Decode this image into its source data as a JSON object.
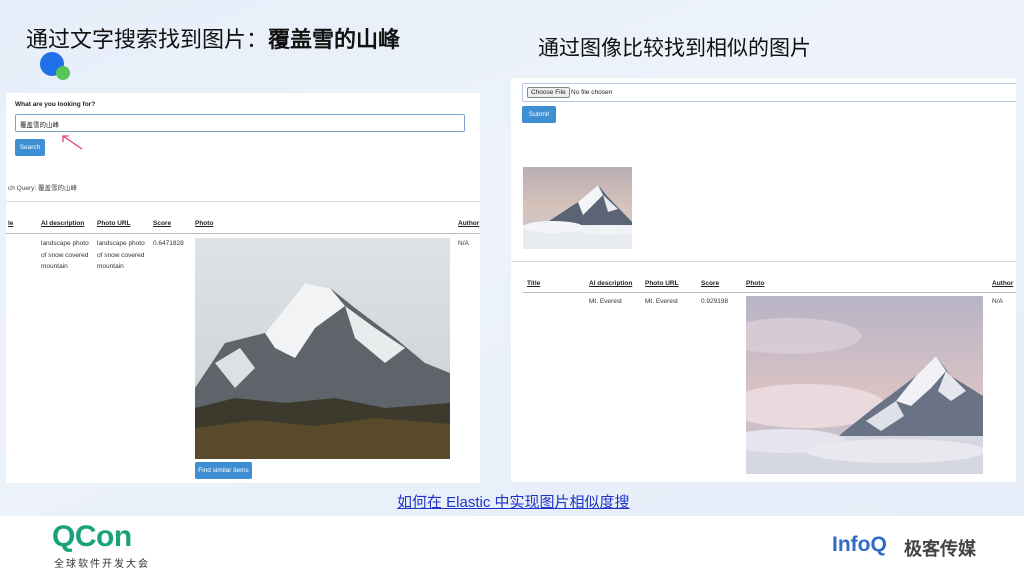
{
  "slide": {
    "title_left_prefix": "通过文字搜索找到图片：",
    "title_left_bold": "覆盖雪的山峰",
    "title_right": "通过图像比较找到相似的图片",
    "bottom_link": "如何在 Elastic 中实现图片相似度搜"
  },
  "left_app": {
    "prompt_label": "What are you looking for?",
    "search_value": "覆盖雪的山峰",
    "search_button": "Search",
    "query_text": "ch Query: 覆盖雪的山峰",
    "columns": [
      "le",
      "AI description",
      "Photo URL",
      "Score",
      "Photo",
      "Author"
    ],
    "row": {
      "ai_description": [
        "landscape photo",
        "of snow covered",
        "mountain"
      ],
      "photo_url": [
        "landscape photo",
        "of snow covered",
        "mountain"
      ],
      "score": "0.6471828",
      "author": "N/A"
    },
    "find_similar_button": "Find similar items"
  },
  "right_app": {
    "choose_file_button": "Choose File",
    "file_status": "No file chosen",
    "submit_button": "Submit",
    "columns": [
      "Title",
      "AI description",
      "Photo URL",
      "Score",
      "Photo",
      "Author"
    ],
    "row": {
      "ai_description": "Mt. Everest",
      "photo_url": "Mt. Everest",
      "score": "0.929198",
      "author": "N/A"
    }
  },
  "footer": {
    "qcon_logo": "QCon",
    "qcon_subtitle": "全球软件开发大会",
    "infoq_logo": "InfoQ",
    "infoq_subtitle": "极客传媒"
  },
  "colors": {
    "button": "#3d8ed3",
    "link": "#2b5ec6",
    "qcon_green": "#1aa37a",
    "infoq_blue": "#2e6bc6"
  }
}
